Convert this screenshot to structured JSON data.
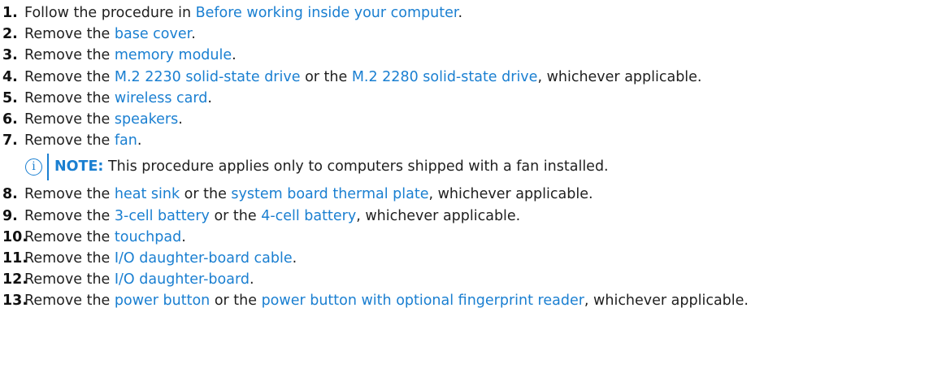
{
  "steps": [
    {
      "num": "1.",
      "parts": [
        {
          "t": "Follow the procedure in "
        },
        {
          "t": "Before working inside your computer",
          "link": true
        },
        {
          "t": "."
        }
      ]
    },
    {
      "num": "2.",
      "parts": [
        {
          "t": "Remove the "
        },
        {
          "t": "base cover",
          "link": true
        },
        {
          "t": "."
        }
      ]
    },
    {
      "num": "3.",
      "parts": [
        {
          "t": "Remove the "
        },
        {
          "t": "memory module",
          "link": true
        },
        {
          "t": "."
        }
      ]
    },
    {
      "num": "4.",
      "parts": [
        {
          "t": "Remove the "
        },
        {
          "t": "M.2 2230 solid-state drive",
          "link": true
        },
        {
          "t": " or the "
        },
        {
          "t": "M.2 2280 solid-state drive",
          "link": true
        },
        {
          "t": ", whichever applicable."
        }
      ]
    },
    {
      "num": "5.",
      "parts": [
        {
          "t": "Remove the "
        },
        {
          "t": "wireless card",
          "link": true
        },
        {
          "t": "."
        }
      ]
    },
    {
      "num": "6.",
      "parts": [
        {
          "t": "Remove the "
        },
        {
          "t": "speakers",
          "link": true
        },
        {
          "t": "."
        }
      ]
    },
    {
      "num": "7.",
      "parts": [
        {
          "t": "Remove the "
        },
        {
          "t": "fan",
          "link": true
        },
        {
          "t": "."
        }
      ],
      "note": {
        "icon": "info-icon",
        "label": "NOTE:",
        "text": " This procedure applies only to computers shipped with a fan installed."
      }
    },
    {
      "num": "8.",
      "parts": [
        {
          "t": "Remove the "
        },
        {
          "t": "heat sink",
          "link": true
        },
        {
          "t": " or the "
        },
        {
          "t": "system board thermal plate",
          "link": true
        },
        {
          "t": ", whichever applicable."
        }
      ]
    },
    {
      "num": "9.",
      "parts": [
        {
          "t": "Remove the "
        },
        {
          "t": "3-cell battery",
          "link": true
        },
        {
          "t": " or the "
        },
        {
          "t": "4-cell battery",
          "link": true
        },
        {
          "t": ", whichever applicable."
        }
      ]
    },
    {
      "num": "10.",
      "parts": [
        {
          "t": "Remove the "
        },
        {
          "t": "touchpad",
          "link": true
        },
        {
          "t": "."
        }
      ]
    },
    {
      "num": "11.",
      "parts": [
        {
          "t": "Remove the "
        },
        {
          "t": "I/O daughter-board cable",
          "link": true
        },
        {
          "t": "."
        }
      ]
    },
    {
      "num": "12.",
      "parts": [
        {
          "t": "Remove the "
        },
        {
          "t": "I/O daughter-board",
          "link": true
        },
        {
          "t": "."
        }
      ]
    },
    {
      "num": "13.",
      "parts": [
        {
          "t": "Remove the "
        },
        {
          "t": "power button",
          "link": true
        },
        {
          "t": " or the "
        },
        {
          "t": "power button with optional fingerprint reader",
          "link": true
        },
        {
          "t": ", whichever applicable."
        }
      ]
    }
  ],
  "colors": {
    "link": "#1a7fd1",
    "text": "#1f1f1f",
    "number": "#111111"
  }
}
